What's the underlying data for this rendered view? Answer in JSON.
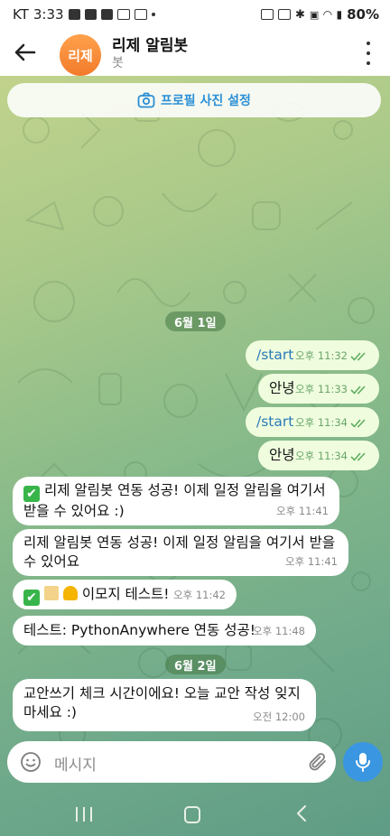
{
  "status_bar": {
    "carrier": "KT",
    "time": "3:33",
    "battery": "80%"
  },
  "header": {
    "avatar_initials": "리제",
    "title": "리제 알림봇",
    "subtitle": "봇"
  },
  "profile_bar": {
    "label": "프로필 사진 설정"
  },
  "date_chips": [
    "6월 1일",
    "6월 2일"
  ],
  "messages": [
    {
      "direction": "out",
      "text": "/start",
      "time": "오후 11:32",
      "read": true
    },
    {
      "direction": "out",
      "text": "안녕",
      "time": "오후 11:33",
      "read": true
    },
    {
      "direction": "out",
      "text": "/start",
      "time": "오후 11:34",
      "read": true
    },
    {
      "direction": "out",
      "text": "안녕",
      "time": "오후 11:34",
      "read": true
    },
    {
      "direction": "in",
      "emoji": "✔",
      "text": "리제 알림봇 연동 성공! 이제 일정 알림을 여기서 받을 수 있어요 :)",
      "time": "오후 11:41"
    },
    {
      "direction": "in",
      "text": "리제 알림봇 연동 성공! 이제 일정 알림을 여기서 받을 수 있어요",
      "time": "오후 11:41"
    },
    {
      "direction": "in",
      "emoji": "✔",
      "text": "이모지 테스트!",
      "time": "오후 11:42"
    },
    {
      "direction": "in",
      "text": "테스트: PythonAnywhere 연동 성공!",
      "time": "오후 11:48"
    },
    {
      "direction": "in",
      "text": "교안쓰기 체크 시간이에요! 오늘 교안 작성 잊지 마세요 :)",
      "time": "오전 12:00"
    }
  ],
  "input": {
    "placeholder": "메시지"
  },
  "colors": {
    "outgoing_bubble": "#effdde",
    "incoming_bubble": "#ffffff",
    "accent": "#3a96e0",
    "avatar": "#f27a2b"
  }
}
